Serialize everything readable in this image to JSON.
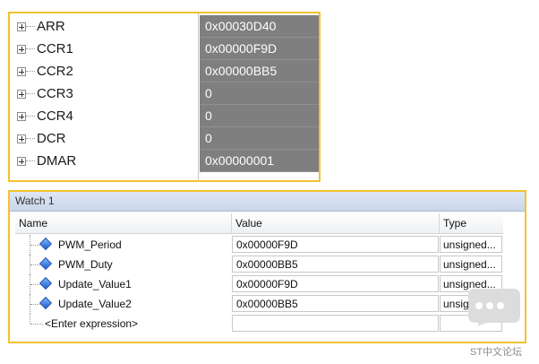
{
  "registers": [
    {
      "name": "ARR",
      "value": "0x00030D40"
    },
    {
      "name": "CCR1",
      "value": "0x00000F9D"
    },
    {
      "name": "CCR2",
      "value": "0x00000BB5"
    },
    {
      "name": "CCR3",
      "value": "0"
    },
    {
      "name": "CCR4",
      "value": "0"
    },
    {
      "name": "DCR",
      "value": "0"
    },
    {
      "name": "DMAR",
      "value": "0x00000001"
    }
  ],
  "watch": {
    "title": "Watch 1",
    "columns": {
      "name": "Name",
      "value": "Value",
      "type": "Type"
    },
    "rows": [
      {
        "name": "PWM_Period",
        "value": "0x00000F9D",
        "type": "unsigned..."
      },
      {
        "name": "PWM_Duty",
        "value": "0x00000BB5",
        "type": "unsigned..."
      },
      {
        "name": "Update_Value1",
        "value": "0x00000F9D",
        "type": "unsigned..."
      },
      {
        "name": "Update_Value2",
        "value": "0x00000BB5",
        "type": "unsigned..."
      }
    ],
    "enter_expression": "<Enter expression>"
  },
  "watermark": {
    "text": "ST中文论坛",
    "icon": "chat-bubble-icon"
  },
  "colors": {
    "highlight_border": "#f2c230",
    "register_value_bg": "#7f7f7f"
  }
}
